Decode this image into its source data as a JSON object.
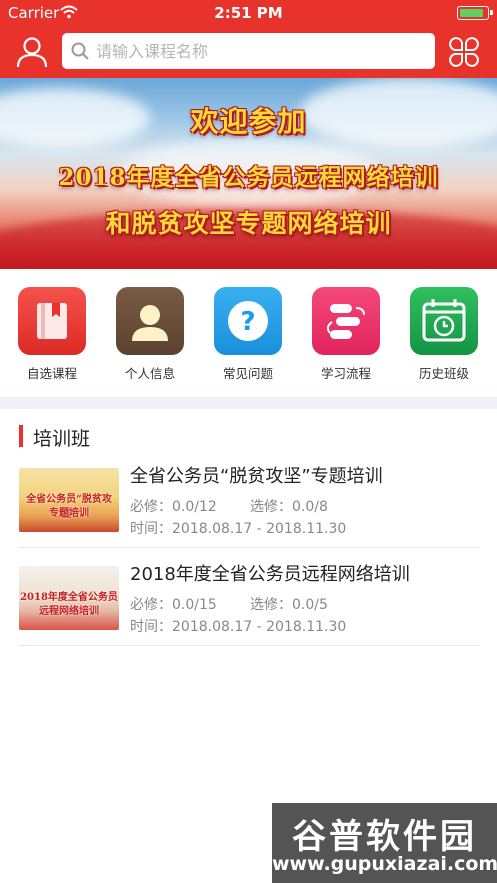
{
  "status_bar": {
    "carrier": "Carrier",
    "time": "2:51 PM",
    "battery_level": 0.9
  },
  "nav": {
    "search_placeholder": "请输入课程名称"
  },
  "banner": {
    "line1": "欢迎参加",
    "line2": "2018年度全省公务员远程网络培训",
    "line3": "和脱贫攻坚专题网络培训"
  },
  "quick_menu": [
    {
      "label": "自选课程",
      "icon": "book-icon",
      "color": "#e8322c"
    },
    {
      "label": "个人信息",
      "icon": "person-icon",
      "color": "#6b4f3a"
    },
    {
      "label": "常见问题",
      "icon": "question-icon",
      "color": "#1e9be6"
    },
    {
      "label": "学习流程",
      "icon": "process-icon",
      "color": "#ec2f6b"
    },
    {
      "label": "历史班级",
      "icon": "calendar-clock-icon",
      "color": "#16a34a"
    }
  ],
  "section": {
    "title": "培训班"
  },
  "courses": [
    {
      "title": "全省公务员“脱贫攻坚”专题培训",
      "required": "必修：0.0/12",
      "elective": "选修：0.0/8",
      "date": "时间：2018.08.17 - 2018.11.30",
      "thumb_text1": "全省公务员“脱贫攻坚”",
      "thumb_text2": "专题培训"
    },
    {
      "title": "2018年度全省公务员远程网络培训",
      "required": "必修：0.0/15",
      "elective": "选修：0.0/5",
      "date": "时间：2018.08.17 - 2018.11.30",
      "thumb_text1": "2018年度全省公务员",
      "thumb_text2": "远程网络培训"
    }
  ],
  "watermark": {
    "title": "谷普软件园",
    "url": "www.gupuxiazai.com"
  },
  "colors": {
    "brand_red": "#e8322c",
    "band_gray": "#edf0f4"
  }
}
